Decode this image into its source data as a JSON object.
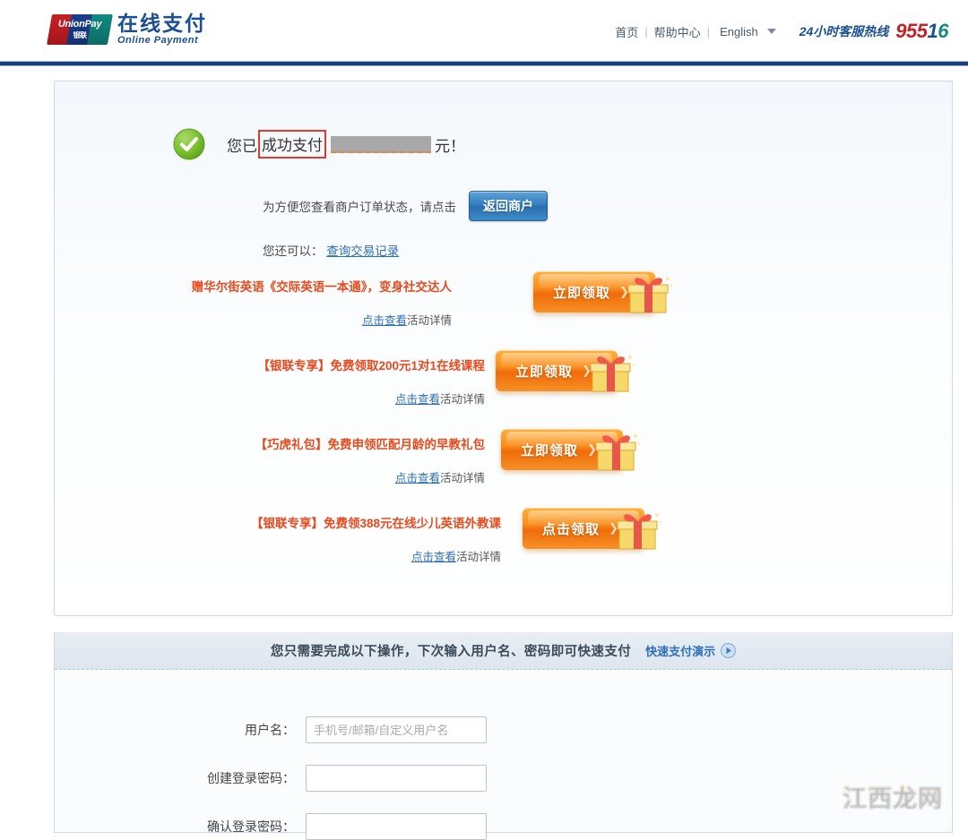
{
  "header": {
    "logo": {
      "mark_top": "UnionPay",
      "mark_bottom": "银联",
      "title_cn": "在线支付",
      "title_en": "Online  Payment"
    },
    "nav": {
      "home": "首页",
      "sep1": "|",
      "help": "帮助中心",
      "sep2": "|",
      "language": "English"
    },
    "hotline": {
      "label": "24小时客服热线",
      "num_part1": "955",
      "num_part2": "1",
      "num_part3": "6"
    }
  },
  "success": {
    "prefix": "您已",
    "highlight": "成功支付",
    "suffix": "元！",
    "line2_text": "为方便您查看商户订单状态，请点击",
    "return_button": "返回商户",
    "line3_prefix": "您还可以：",
    "line3_link": "查询交易记录"
  },
  "promos": [
    {
      "title": "赠华尔街英语《交际英语一本通》，变身社交达人",
      "link": "点击查看",
      "sub_tail": "活动详情",
      "button_label": "立即领取"
    },
    {
      "title": "【银联专享】免费领取200元1对1在线课程",
      "link": "点击查看",
      "sub_tail": "活动详情",
      "button_label": "立即领取"
    },
    {
      "title": "【巧虎礼包】免费申领匹配月龄的早教礼包",
      "link": "点击查看",
      "sub_tail": "活动详情",
      "button_label": "立即领取"
    },
    {
      "title": "【银联专享】免费领388元在线少儿英语外教课",
      "link": "点击查看",
      "sub_tail": "活动详情",
      "button_label": "点击领取"
    }
  ],
  "quickpay": {
    "heading": "您只需要完成以下操作，下次输入用户名、密码即可快速支付",
    "demo_link": "快速支付演示",
    "fields": [
      {
        "label": "用户名：",
        "value": "",
        "placeholder": "手机号/邮箱/自定义用户名"
      },
      {
        "label": "创建登录密码：",
        "value": "",
        "placeholder": ""
      },
      {
        "label": "确认登录密码：",
        "value": "",
        "placeholder": ""
      }
    ]
  },
  "watermark": "江西龙网",
  "colors": {
    "brand_blue": "#1b4f93",
    "rule_navy": "#1b3f7a",
    "promo_orange": "#e8491d",
    "link_blue": "#2f6fb5",
    "highlight_red": "#e23b2e",
    "success_green": "#6ab42e"
  }
}
